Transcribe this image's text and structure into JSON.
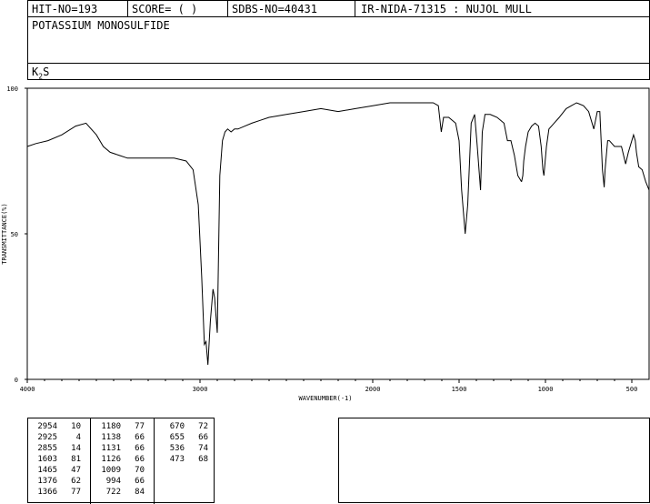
{
  "header": {
    "hit_no": "HIT-NO=193",
    "score": "SCORE=  (   )",
    "sdbs_no": "SDBS-NO=40431",
    "ir_info": "IR-NIDA-71315 : NUJOL MULL"
  },
  "compound": {
    "name": "POTASSIUM MONOSULFIDE",
    "formula_k": "K",
    "formula_sub": "2",
    "formula_s": "S"
  },
  "chart_data": {
    "type": "line",
    "title": "",
    "xlabel": "WAVENUMBER(-1)",
    "ylabel": "TRANSMITTANCE(%)",
    "xlim": [
      4000,
      400
    ],
    "ylim": [
      0,
      100
    ],
    "x_ticks": [
      4000,
      3000,
      2000,
      1500,
      1000,
      500
    ],
    "y_ticks": [
      0,
      50,
      100
    ],
    "grid": false,
    "series": [
      {
        "x": [
          4000,
          3950,
          3880,
          3800,
          3720,
          3660,
          3600,
          3560,
          3520,
          3470,
          3420,
          3360,
          3300,
          3230,
          3150,
          3080,
          3040,
          3010,
          2990,
          2975,
          2965,
          2954,
          2940,
          2925,
          2915,
          2900,
          2885,
          2870,
          2855,
          2840,
          2820,
          2800,
          2780,
          2740,
          2700,
          2650,
          2600,
          2500,
          2400,
          2300,
          2200,
          2100,
          2000,
          1900,
          1800,
          1720,
          1650,
          1620,
          1603,
          1590,
          1560,
          1520,
          1500,
          1485,
          1465,
          1450,
          1430,
          1410,
          1395,
          1376,
          1366,
          1350,
          1320,
          1280,
          1240,
          1220,
          1200,
          1180,
          1160,
          1140,
          1138,
          1131,
          1126,
          1115,
          1100,
          1080,
          1060,
          1040,
          1025,
          1015,
          1009,
          994,
          980,
          950,
          920,
          880,
          850,
          820,
          780,
          750,
          720,
          700,
          685,
          670,
          660,
          655,
          640,
          630,
          600,
          580,
          560,
          536,
          520,
          490,
          480,
          473,
          460,
          440,
          420,
          400
        ],
        "y": [
          80,
          81,
          82,
          84,
          87,
          88,
          84,
          80,
          78,
          77,
          76,
          76,
          76,
          76,
          76,
          75,
          72,
          60,
          35,
          12,
          13,
          5,
          20,
          31,
          28,
          16,
          70,
          82,
          85,
          86,
          85,
          86,
          86,
          87,
          88,
          89,
          90,
          91,
          92,
          93,
          92,
          93,
          94,
          95,
          95,
          95,
          95,
          94,
          85,
          90,
          90,
          88,
          82,
          65,
          50,
          60,
          88,
          91,
          80,
          65,
          85,
          91,
          91,
          90,
          88,
          82,
          82,
          77,
          70,
          68,
          68,
          70,
          75,
          80,
          85,
          87,
          88,
          87,
          80,
          72,
          70,
          80,
          86,
          88,
          90,
          93,
          94,
          95,
          94,
          92,
          86,
          92,
          92,
          72,
          66,
          72,
          82,
          82,
          80,
          80,
          80,
          74,
          78,
          84,
          82,
          78,
          73,
          72,
          68,
          65
        ]
      }
    ]
  },
  "peaks": [
    [
      "2954",
      "10",
      "1180",
      "77",
      "670",
      "72"
    ],
    [
      "2925",
      "4",
      "1138",
      "66",
      "655",
      "66"
    ],
    [
      "2855",
      "14",
      "1131",
      "66",
      "536",
      "74"
    ],
    [
      "1603",
      "81",
      "1126",
      "66",
      "473",
      "68"
    ],
    [
      "1465",
      "47",
      "1009",
      "70",
      "",
      ""
    ],
    [
      "1376",
      "62",
      "994",
      "66",
      "",
      ""
    ],
    [
      "1366",
      "77",
      "722",
      "84",
      "",
      ""
    ]
  ]
}
